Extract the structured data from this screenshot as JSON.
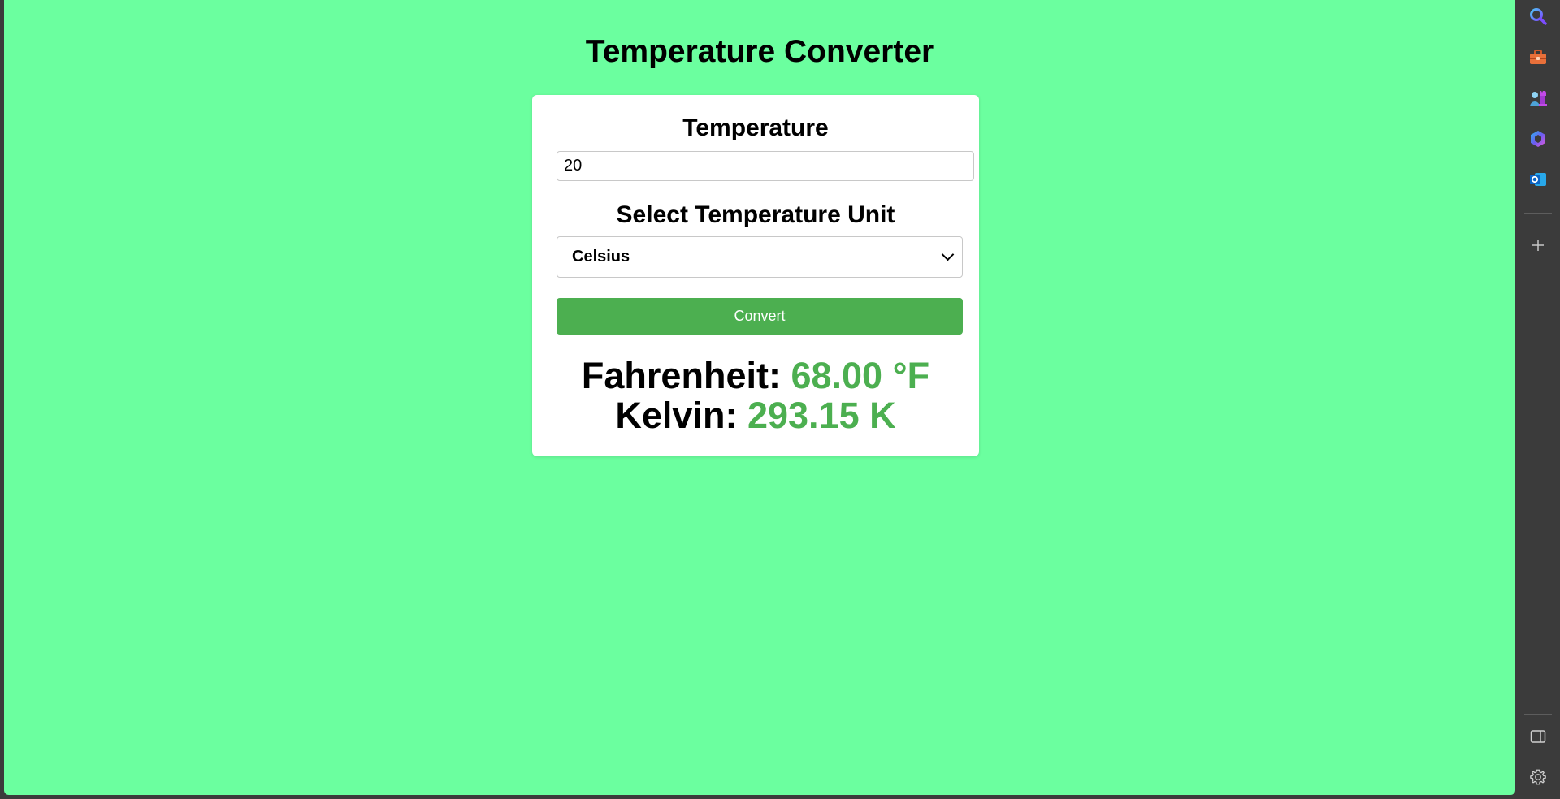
{
  "page": {
    "title": "Temperature Converter",
    "background": "#6bff9f"
  },
  "form": {
    "temperature_label": "Temperature",
    "temperature_value": "20",
    "unit_label": "Select Temperature Unit",
    "unit_selected": "Celsius",
    "convert_label": "Convert"
  },
  "results": {
    "fahrenheit_label": "Fahrenheit:",
    "fahrenheit_value": "68.00 °F",
    "kelvin_label": "Kelvin:",
    "kelvin_value": "293.15 K",
    "value_color": "#4caf50"
  },
  "browser_sidebar": {
    "icons": [
      "search-icon",
      "toolbox-icon",
      "games-icon",
      "copilot-icon",
      "outlook-icon",
      "add-icon",
      "sidebar-toggle-icon",
      "settings-icon"
    ]
  }
}
